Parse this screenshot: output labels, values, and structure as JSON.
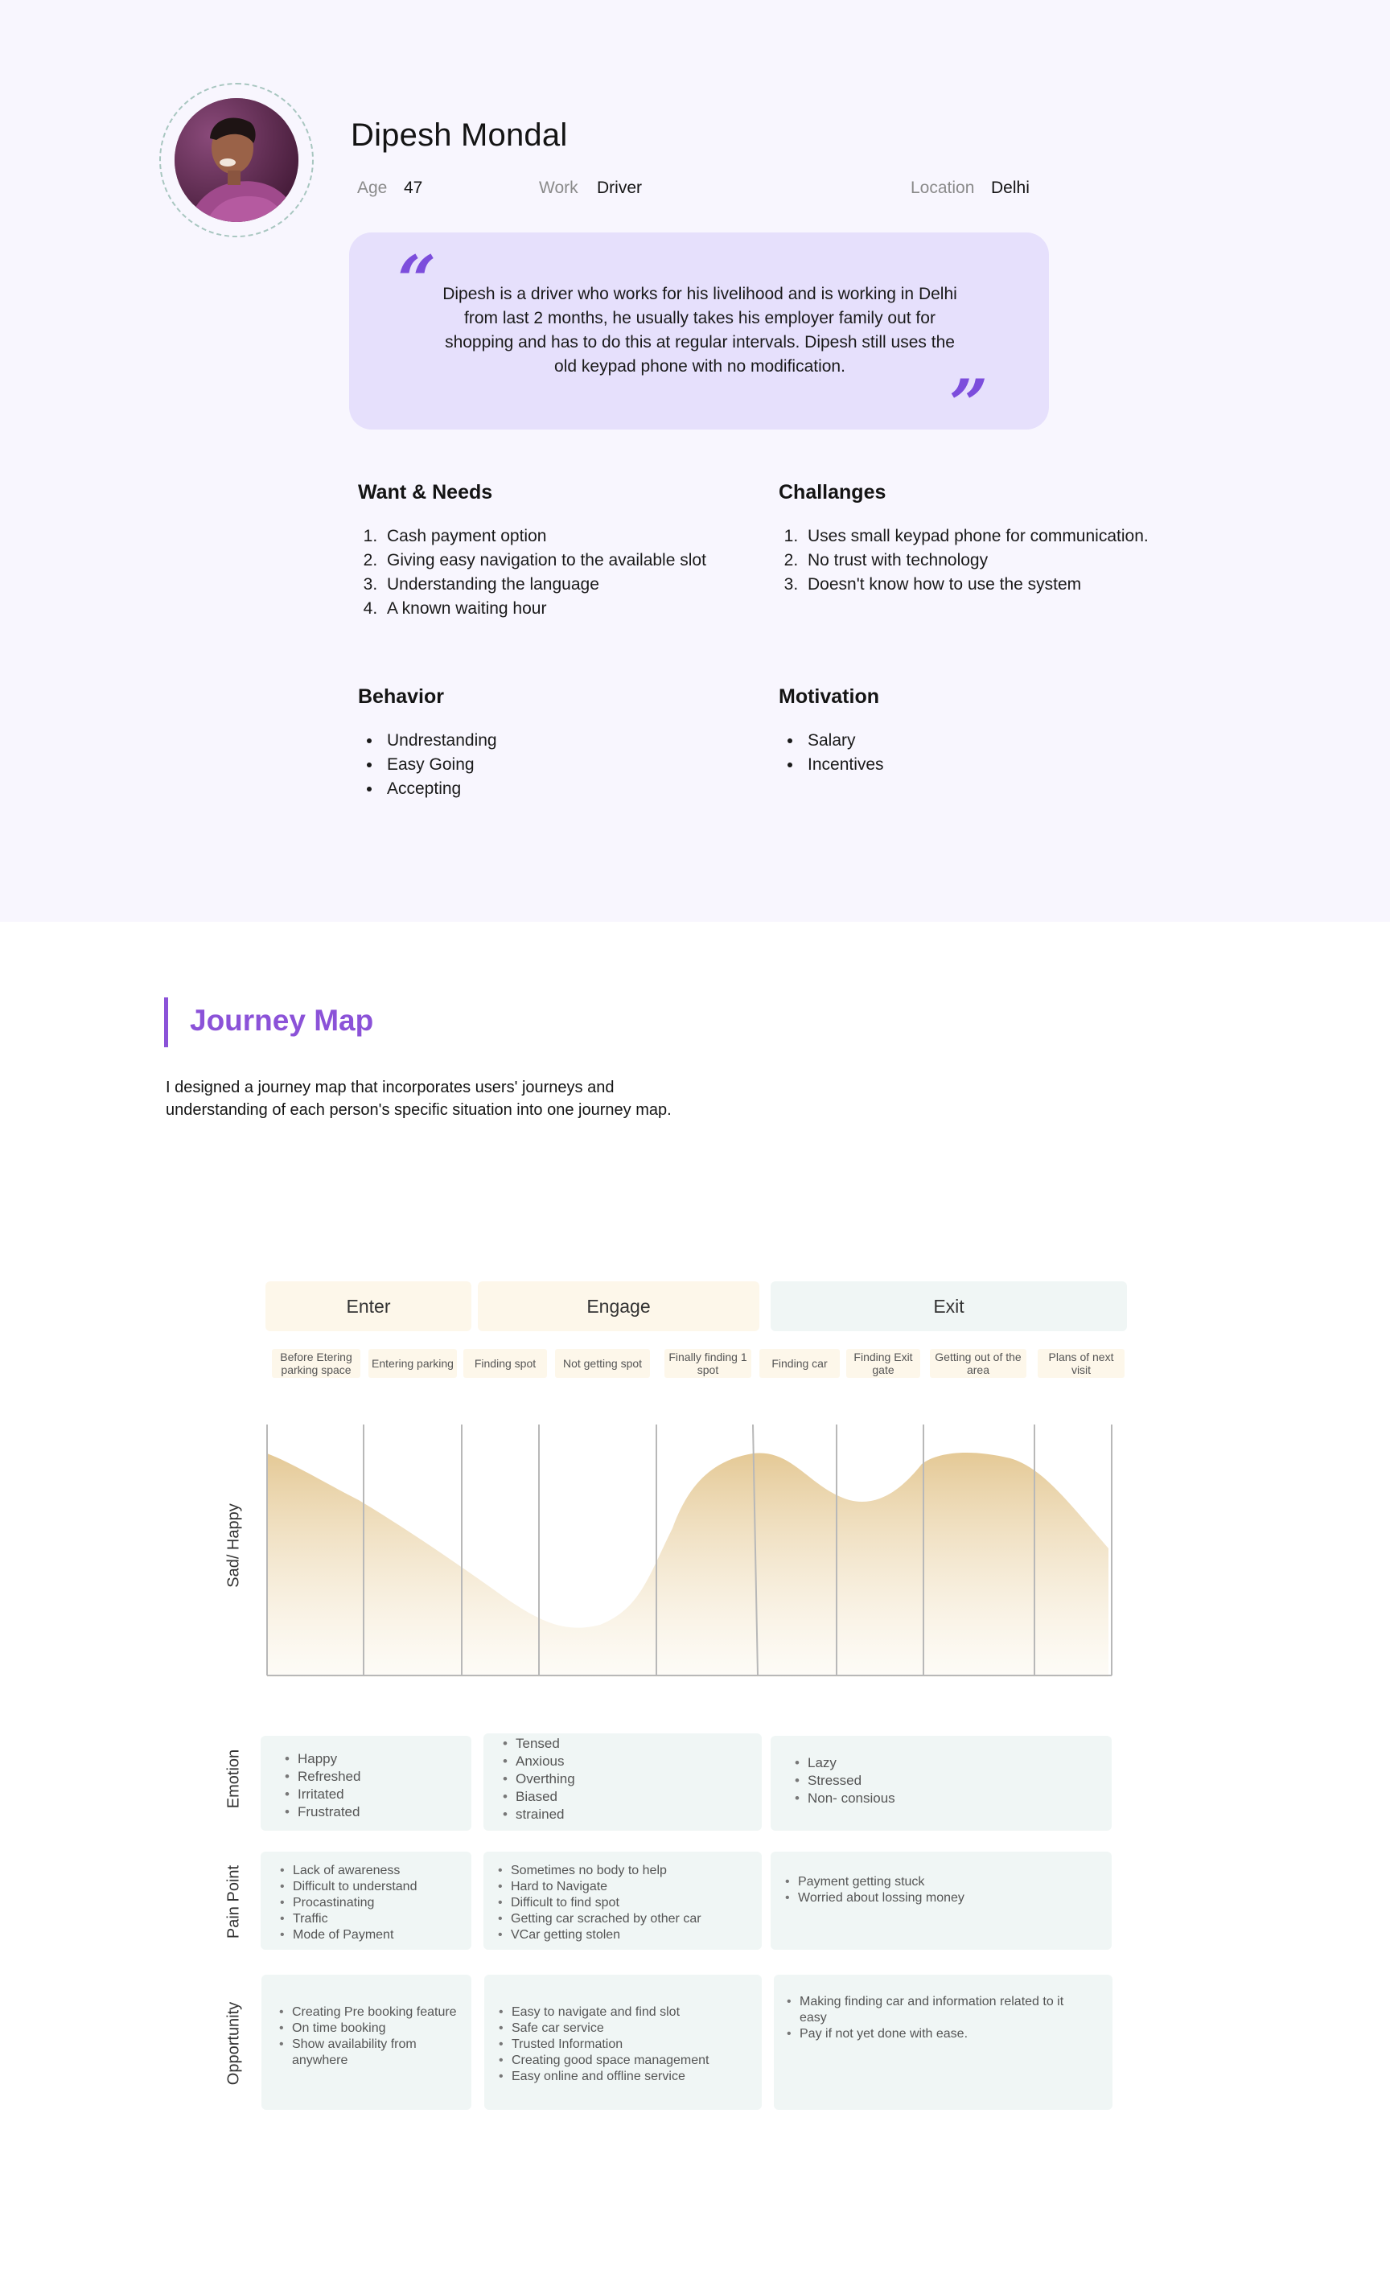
{
  "persona": {
    "name": "Dipesh Mondal",
    "age_label": "Age",
    "age_value": "47",
    "work_label": "Work",
    "work_value": "Driver",
    "location_label": "Location",
    "location_value": "Delhi",
    "quote_open": "“",
    "quote_close": "”",
    "quote": "Dipesh is a driver who works for his livelihood and is working in Delhi from last 2 months, he usually takes his employer family out for shopping and has to do this at regular intervals. Dipesh still uses the old keypad phone with no modification.",
    "wants_title": "Want & Needs",
    "wants": [
      "Cash payment option",
      "Giving easy navigation to the available slot",
      "Understanding the language",
      "A known waiting hour"
    ],
    "challenges_title": "Challanges",
    "challenges": [
      "Uses small keypad phone for communication.",
      "No trust with technology",
      "Doesn't know how to use the system"
    ],
    "behavior_title": "Behavior",
    "behavior": [
      "Undrestanding",
      "Easy Going",
      "Accepting"
    ],
    "motivation_title": "Motivation",
    "motivation": [
      "Salary",
      "Incentives"
    ]
  },
  "journey": {
    "title": "Journey Map",
    "description": "I designed a journey map that incorporates users' journeys and understanding of each person's specific situation into one journey map.",
    "phases": [
      "Enter",
      "Engage",
      "Exit"
    ],
    "phase_colors": [
      "#fdf7ea",
      "#fdf7ea",
      "#f0f6f5"
    ],
    "steps": [
      "Before Etering parking space",
      "Entering parking",
      "Finding spot",
      "Not getting spot",
      "Finally finding 1 spot",
      "Finding car",
      "Finding Exit gate",
      "Getting out of the area",
      "Plans of next visit"
    ],
    "chart_axis_label": "Sad/ Happy",
    "rows": [
      {
        "label": "Emotion",
        "cells": [
          [
            "Happy",
            "Refreshed",
            "Irritated",
            "Frustrated"
          ],
          [
            "Tensed",
            "Anxious",
            "Overthing",
            "Biased",
            "strained"
          ],
          [
            "Lazy",
            "Stressed",
            "Non- consious"
          ]
        ]
      },
      {
        "label": "Pain Point",
        "cells": [
          [
            "Lack of awareness",
            "Difficult to understand",
            "Procastinating",
            "Traffic",
            "Mode of Payment"
          ],
          [
            "Sometimes no body to help",
            "Hard to Navigate",
            "Difficult to find spot",
            "Getting car scrached by other car",
            "VCar getting stolen"
          ],
          [
            "Payment getting stuck",
            "Worried about lossing money"
          ]
        ]
      },
      {
        "label": "Opportunity",
        "cells": [
          [
            "Creating Pre booking feature",
            "On time booking",
            "Show availability from anywhere"
          ],
          [
            "Easy to navigate and find slot",
            "Safe car service",
            "Trusted Information",
            "Creating good space management",
            "Easy online and offline service"
          ],
          [
            "Making finding car and information related to it easy",
            "Pay if not yet done with ease."
          ]
        ]
      }
    ]
  },
  "colors": {
    "accent": "#8b52d8",
    "quote_bg": "#e6e0fc",
    "persona_bg": "#f8f6fe",
    "curve_fill": "#e3c690",
    "cell_bg": "#f0f6f5"
  }
}
